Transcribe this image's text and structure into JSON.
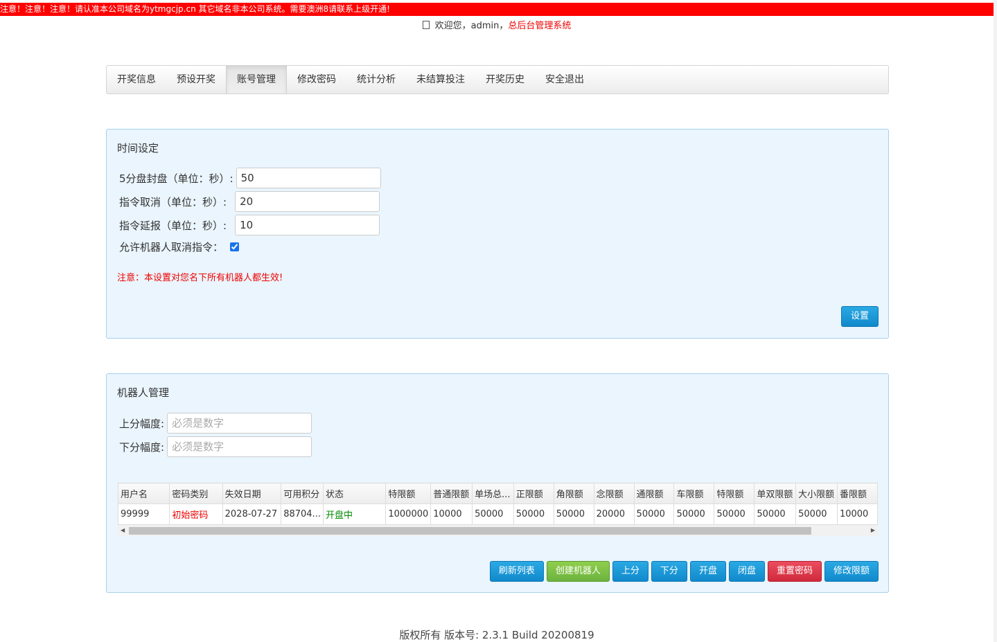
{
  "notice": "注意！注意！注意！请认准本公司域名为ytmgcjp.cn 其它域名非本公司系统。需要澳洲8请联系上级开通!",
  "header": {
    "welcome_prefix": "欢迎您，admin，",
    "system_name": "总后台管理系统"
  },
  "nav": {
    "tabs": [
      "开奖信息",
      "预设开奖",
      "账号管理",
      "修改密码",
      "统计分析",
      "未结算投注",
      "开奖历史",
      "安全退出"
    ],
    "active": "账号管理"
  },
  "time_panel": {
    "title": "时间设定",
    "fields": [
      {
        "label": "5分盘封盘（单位：秒）:",
        "value": "50"
      },
      {
        "label": "指令取消（单位：秒）:",
        "value": "20"
      },
      {
        "label": "指令延报（单位：秒）:",
        "value": "10"
      }
    ],
    "robot_cancel_label": "允许机器人取消指令：",
    "robot_cancel_checked": true,
    "warning": "注意：本设置对您名下所有机器人都生效!",
    "set_button": "设置"
  },
  "robot_panel": {
    "title": "机器人管理",
    "up_label": "上分幅度:",
    "up_placeholder": "必须是数字",
    "down_label": "下分幅度:",
    "down_placeholder": "必须是数字",
    "table": {
      "columns": [
        "用户名",
        "密码类别",
        "失效日期",
        "可用积分",
        "状态",
        "特限额",
        "普通限额",
        "单场总...",
        "正限额",
        "角限额",
        "念限额",
        "通限额",
        "车限额",
        "特限额",
        "单双限额",
        "大小限额",
        "番限额"
      ],
      "rows": [
        [
          "99999",
          "初始密码",
          "2028-07-27",
          "88704...",
          "开盘中",
          "1000000",
          "10000",
          "50000",
          "50000",
          "50000",
          "20000",
          "50000",
          "50000",
          "50000",
          "50000",
          "50000",
          "10000"
        ]
      ]
    },
    "buttons": {
      "refresh": "刷新列表",
      "create": "创建机器人",
      "up": "上分",
      "down": "下分",
      "open": "开盘",
      "close": "闭盘",
      "reset": "重置密码",
      "limits": "修改限额"
    }
  },
  "footer": "版权所有 版本号: 2.3.1 Build 20200819",
  "colors": {
    "notice_bg": "#ff0000",
    "panel_bg": "#eaf5fd",
    "primary_button": "#1189cc",
    "success_button": "#6db33f",
    "danger_button": "#cf2a3c",
    "status_open": "#008800",
    "warning_text": "#ee0000"
  }
}
